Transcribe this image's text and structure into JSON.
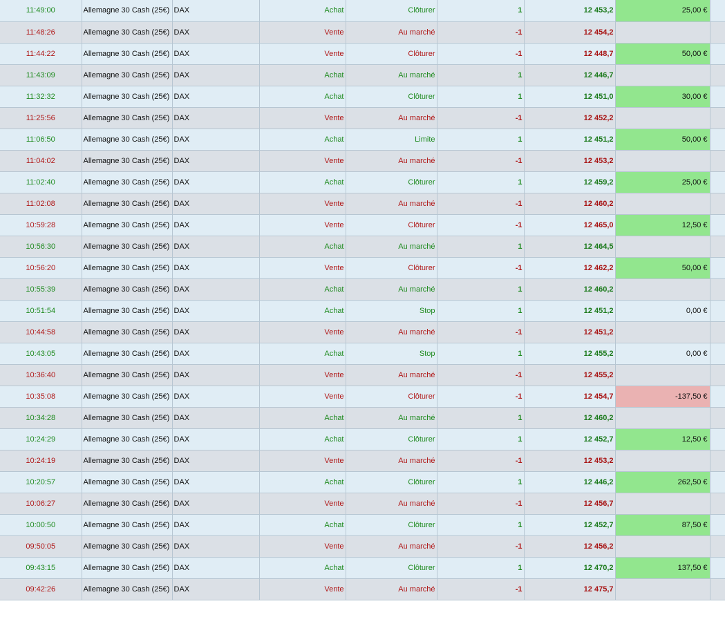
{
  "colors": {
    "buy": "#1e8a1e",
    "sell": "#b01818",
    "row_light": "#e0edf5",
    "row_dark": "#dbe0e6",
    "profit_bg": "#92e68e",
    "loss_bg": "#eab2b2",
    "grid": "#b7c6d2"
  },
  "trades": [
    {
      "time": "11:49:00",
      "instrument": "Allemagne 30 Cash (25€)",
      "underlying": "DAX",
      "direction": "Achat",
      "order_type": "Clôturer",
      "quantity": "1",
      "price": "12 453,2",
      "pnl": "25,00 €",
      "pnl_status": "profit"
    },
    {
      "time": "11:48:26",
      "instrument": "Allemagne 30 Cash (25€)",
      "underlying": "DAX",
      "direction": "Vente",
      "order_type": "Au marché",
      "quantity": "-1",
      "price": "12 454,2",
      "pnl": "",
      "pnl_status": "none"
    },
    {
      "time": "11:44:22",
      "instrument": "Allemagne 30 Cash (25€)",
      "underlying": "DAX",
      "direction": "Vente",
      "order_type": "Clôturer",
      "quantity": "-1",
      "price": "12 448,7",
      "pnl": "50,00 €",
      "pnl_status": "profit"
    },
    {
      "time": "11:43:09",
      "instrument": "Allemagne 30 Cash (25€)",
      "underlying": "DAX",
      "direction": "Achat",
      "order_type": "Au marché",
      "quantity": "1",
      "price": "12 446,7",
      "pnl": "",
      "pnl_status": "none"
    },
    {
      "time": "11:32:32",
      "instrument": "Allemagne 30 Cash (25€)",
      "underlying": "DAX",
      "direction": "Achat",
      "order_type": "Clôturer",
      "quantity": "1",
      "price": "12 451,0",
      "pnl": "30,00 €",
      "pnl_status": "profit"
    },
    {
      "time": "11:25:56",
      "instrument": "Allemagne 30 Cash (25€)",
      "underlying": "DAX",
      "direction": "Vente",
      "order_type": "Au marché",
      "quantity": "-1",
      "price": "12 452,2",
      "pnl": "",
      "pnl_status": "none"
    },
    {
      "time": "11:06:50",
      "instrument": "Allemagne 30 Cash (25€)",
      "underlying": "DAX",
      "direction": "Achat",
      "order_type": "Limite",
      "quantity": "1",
      "price": "12 451,2",
      "pnl": "50,00 €",
      "pnl_status": "profit"
    },
    {
      "time": "11:04:02",
      "instrument": "Allemagne 30 Cash (25€)",
      "underlying": "DAX",
      "direction": "Vente",
      "order_type": "Au marché",
      "quantity": "-1",
      "price": "12 453,2",
      "pnl": "",
      "pnl_status": "none"
    },
    {
      "time": "11:02:40",
      "instrument": "Allemagne 30 Cash (25€)",
      "underlying": "DAX",
      "direction": "Achat",
      "order_type": "Clôturer",
      "quantity": "1",
      "price": "12 459,2",
      "pnl": "25,00 €",
      "pnl_status": "profit"
    },
    {
      "time": "11:02:08",
      "instrument": "Allemagne 30 Cash (25€)",
      "underlying": "DAX",
      "direction": "Vente",
      "order_type": "Au marché",
      "quantity": "-1",
      "price": "12 460,2",
      "pnl": "",
      "pnl_status": "none"
    },
    {
      "time": "10:59:28",
      "instrument": "Allemagne 30 Cash (25€)",
      "underlying": "DAX",
      "direction": "Vente",
      "order_type": "Clôturer",
      "quantity": "-1",
      "price": "12 465,0",
      "pnl": "12,50 €",
      "pnl_status": "profit"
    },
    {
      "time": "10:56:30",
      "instrument": "Allemagne 30 Cash (25€)",
      "underlying": "DAX",
      "direction": "Achat",
      "order_type": "Au marché",
      "quantity": "1",
      "price": "12 464,5",
      "pnl": "",
      "pnl_status": "none"
    },
    {
      "time": "10:56:20",
      "instrument": "Allemagne 30 Cash (25€)",
      "underlying": "DAX",
      "direction": "Vente",
      "order_type": "Clôturer",
      "quantity": "-1",
      "price": "12 462,2",
      "pnl": "50,00 €",
      "pnl_status": "profit"
    },
    {
      "time": "10:55:39",
      "instrument": "Allemagne 30 Cash (25€)",
      "underlying": "DAX",
      "direction": "Achat",
      "order_type": "Au marché",
      "quantity": "1",
      "price": "12 460,2",
      "pnl": "",
      "pnl_status": "none"
    },
    {
      "time": "10:51:54",
      "instrument": "Allemagne 30 Cash (25€)",
      "underlying": "DAX",
      "direction": "Achat",
      "order_type": "Stop",
      "quantity": "1",
      "price": "12 451,2",
      "pnl": "0,00 €",
      "pnl_status": "zero"
    },
    {
      "time": "10:44:58",
      "instrument": "Allemagne 30 Cash (25€)",
      "underlying": "DAX",
      "direction": "Vente",
      "order_type": "Au marché",
      "quantity": "-1",
      "price": "12 451,2",
      "pnl": "",
      "pnl_status": "none"
    },
    {
      "time": "10:43:05",
      "instrument": "Allemagne 30 Cash (25€)",
      "underlying": "DAX",
      "direction": "Achat",
      "order_type": "Stop",
      "quantity": "1",
      "price": "12 455,2",
      "pnl": "0,00 €",
      "pnl_status": "zero"
    },
    {
      "time": "10:36:40",
      "instrument": "Allemagne 30 Cash (25€)",
      "underlying": "DAX",
      "direction": "Vente",
      "order_type": "Au marché",
      "quantity": "-1",
      "price": "12 455,2",
      "pnl": "",
      "pnl_status": "none"
    },
    {
      "time": "10:35:08",
      "instrument": "Allemagne 30 Cash (25€)",
      "underlying": "DAX",
      "direction": "Vente",
      "order_type": "Clôturer",
      "quantity": "-1",
      "price": "12 454,7",
      "pnl": "-137,50 €",
      "pnl_status": "loss"
    },
    {
      "time": "10:34:28",
      "instrument": "Allemagne 30 Cash (25€)",
      "underlying": "DAX",
      "direction": "Achat",
      "order_type": "Au marché",
      "quantity": "1",
      "price": "12 460,2",
      "pnl": "",
      "pnl_status": "none"
    },
    {
      "time": "10:24:29",
      "instrument": "Allemagne 30 Cash (25€)",
      "underlying": "DAX",
      "direction": "Achat",
      "order_type": "Clôturer",
      "quantity": "1",
      "price": "12 452,7",
      "pnl": "12,50 €",
      "pnl_status": "profit"
    },
    {
      "time": "10:24:19",
      "instrument": "Allemagne 30 Cash (25€)",
      "underlying": "DAX",
      "direction": "Vente",
      "order_type": "Au marché",
      "quantity": "-1",
      "price": "12 453,2",
      "pnl": "",
      "pnl_status": "none"
    },
    {
      "time": "10:20:57",
      "instrument": "Allemagne 30 Cash (25€)",
      "underlying": "DAX",
      "direction": "Achat",
      "order_type": "Clôturer",
      "quantity": "1",
      "price": "12 446,2",
      "pnl": "262,50 €",
      "pnl_status": "profit"
    },
    {
      "time": "10:06:27",
      "instrument": "Allemagne 30 Cash (25€)",
      "underlying": "DAX",
      "direction": "Vente",
      "order_type": "Au marché",
      "quantity": "-1",
      "price": "12 456,7",
      "pnl": "",
      "pnl_status": "none"
    },
    {
      "time": "10:00:50",
      "instrument": "Allemagne 30 Cash (25€)",
      "underlying": "DAX",
      "direction": "Achat",
      "order_type": "Clôturer",
      "quantity": "1",
      "price": "12 452,7",
      "pnl": "87,50 €",
      "pnl_status": "profit"
    },
    {
      "time": "09:50:05",
      "instrument": "Allemagne 30 Cash (25€)",
      "underlying": "DAX",
      "direction": "Vente",
      "order_type": "Au marché",
      "quantity": "-1",
      "price": "12 456,2",
      "pnl": "",
      "pnl_status": "none"
    },
    {
      "time": "09:43:15",
      "instrument": "Allemagne 30 Cash (25€)",
      "underlying": "DAX",
      "direction": "Achat",
      "order_type": "Clôturer",
      "quantity": "1",
      "price": "12 470,2",
      "pnl": "137,50 €",
      "pnl_status": "profit"
    },
    {
      "time": "09:42:26",
      "instrument": "Allemagne 30 Cash (25€)",
      "underlying": "DAX",
      "direction": "Vente",
      "order_type": "Au marché",
      "quantity": "-1",
      "price": "12 475,7",
      "pnl": "",
      "pnl_status": "none"
    }
  ]
}
